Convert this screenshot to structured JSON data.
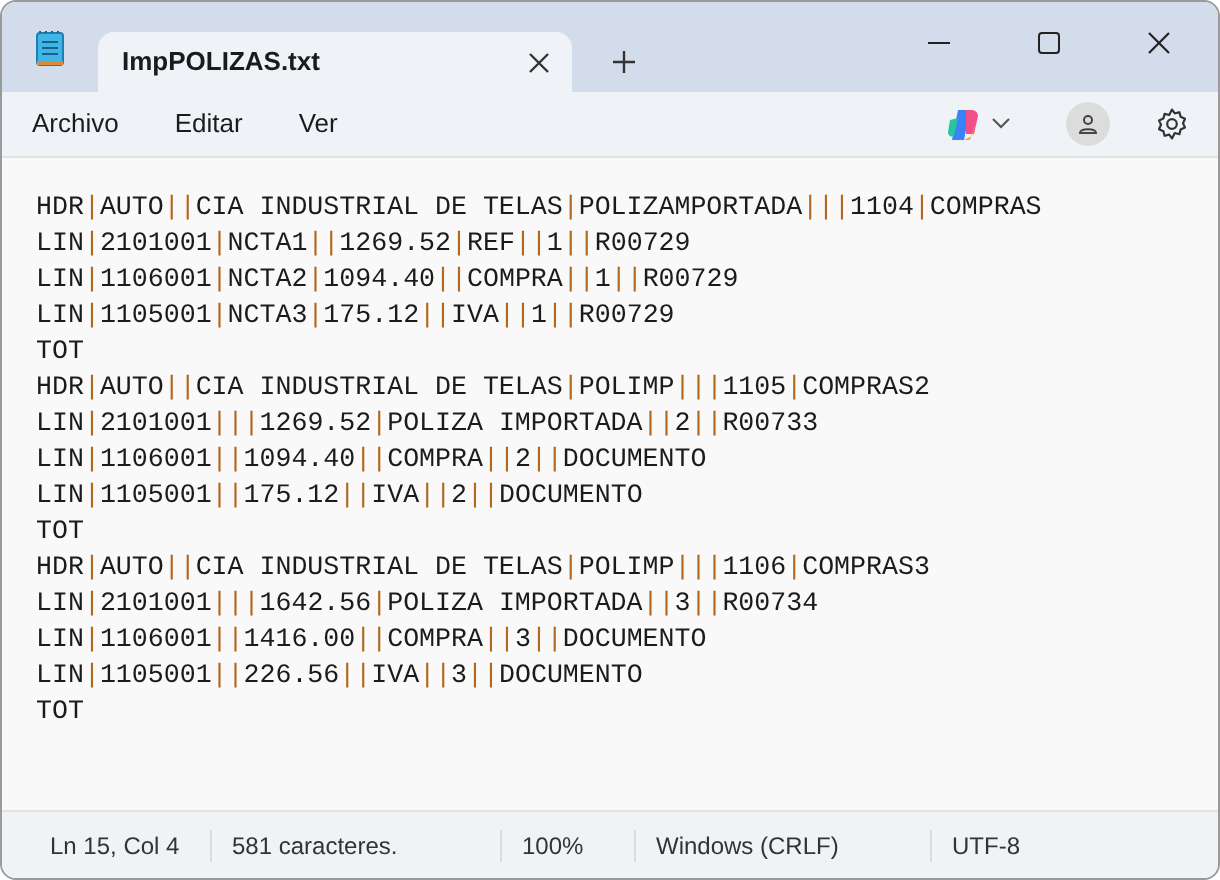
{
  "window": {
    "tab_title": "ImpPOLIZAS.txt"
  },
  "menu": [
    "Archivo",
    "Editar",
    "Ver"
  ],
  "lines": [
    "HDR|AUTO||CIA INDUSTRIAL DE TELAS|POLIZAMPORTADA|||1104|COMPRAS",
    "LIN|2101001|NCTA1||1269.52|REF||1||R00729",
    "LIN|1106001|NCTA2|1094.40||COMPRA||1||R00729",
    "LIN|1105001|NCTA3|175.12||IVA||1||R00729",
    "TOT",
    "HDR|AUTO||CIA INDUSTRIAL DE TELAS|POLIMP|||1105|COMPRAS2",
    "LIN|2101001|||1269.52|POLIZA IMPORTADA||2||R00733",
    "LIN|1106001||1094.40||COMPRA||2||DOCUMENTO",
    "LIN|1105001||175.12||IVA||2||DOCUMENTO",
    "TOT",
    "HDR|AUTO||CIA INDUSTRIAL DE TELAS|POLIMP|||1106|COMPRAS3",
    "LIN|2101001|||1642.56|POLIZA IMPORTADA||3||R00734",
    "LIN|1106001||1416.00||COMPRA||3||DOCUMENTO",
    "LIN|1105001||226.56||IVA||3||DOCUMENTO",
    "TOT"
  ],
  "status_bar": {
    "position": "Ln 15, Col 4",
    "characters": "581 caracteres.",
    "zoom": "100%",
    "line_endings": "Windows (CRLF)",
    "encoding": "UTF-8"
  }
}
